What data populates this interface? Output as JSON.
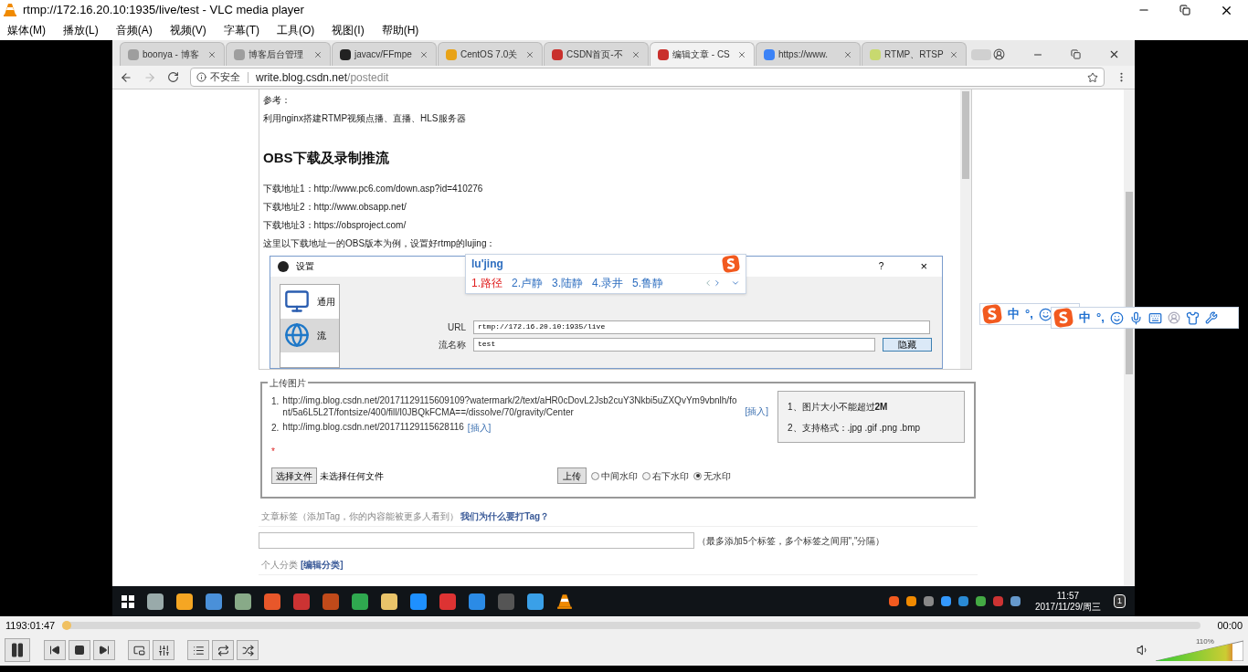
{
  "window": {
    "title": "rtmp://172.16.20.10:1935/live/test - VLC media player"
  },
  "menu": [
    "媒体(M)",
    "播放(L)",
    "音频(A)",
    "视频(V)",
    "字幕(T)",
    "工具(O)",
    "视图(I)",
    "帮助(H)"
  ],
  "browser": {
    "tabs": [
      {
        "label": "boonya - 博客",
        "selected": false,
        "color": "#9e9e9e"
      },
      {
        "label": "博客后台管理",
        "selected": false,
        "color": "#9e9e9e"
      },
      {
        "label": "javacv/FFmpe",
        "selected": false,
        "color": "#222222"
      },
      {
        "label": "CentOS 7.0关",
        "selected": false,
        "color": "#e8a317"
      },
      {
        "label": "CSDN首页-不",
        "selected": false,
        "color": "#c9302c"
      },
      {
        "label": "编辑文章 - CS",
        "selected": true,
        "color": "#c9302c"
      },
      {
        "label": "https://www.",
        "selected": false,
        "color": "#3b82f6"
      },
      {
        "label": "RTMP、RTSP",
        "selected": false,
        "color": "#c8d96f"
      }
    ],
    "address": {
      "security": "不安全",
      "host": "write.blog.csdn.net",
      "path": "/postedit"
    },
    "article": {
      "lines": [
        {
          "kind": "text",
          "text": "参考："
        },
        {
          "kind": "text",
          "text": "利用nginx搭建RTMP视频点播、直播、HLS服务器"
        },
        {
          "kind": "heading",
          "text": "OBS下载及录制推流"
        },
        {
          "kind": "text",
          "text": "下载地址1：http://www.pc6.com/down.asp?id=410276"
        },
        {
          "kind": "text",
          "text": "下载地址2：http://www.obsapp.net/"
        },
        {
          "kind": "text",
          "text": "下载地址3：https://obsproject.com/"
        },
        {
          "kind": "text",
          "text": "这里以下载地址一的OBS版本为例，设置好rtmp的lujing："
        }
      ],
      "obs_dialog": {
        "title": "设置",
        "help": "?",
        "close": "×",
        "sections": [
          {
            "label": "通用",
            "selected": false
          },
          {
            "label": "流",
            "selected": true
          }
        ],
        "fields": [
          {
            "label": "URL",
            "value": "rtmp://172.16.20.10:1935/live"
          },
          {
            "label": "流名称",
            "value": "test"
          }
        ],
        "hide_button": "隐藏"
      }
    },
    "ime": {
      "composition": "lu'jing",
      "candidates": [
        {
          "text": "1.路径",
          "selected": true
        },
        {
          "text": "2.卢静",
          "selected": false
        },
        {
          "text": "3.陆静",
          "selected": false
        },
        {
          "text": "4.录井",
          "selected": false
        },
        {
          "text": "5.鲁静",
          "selected": false
        }
      ]
    },
    "upload": {
      "legend": "上传图片",
      "images": [
        {
          "number": "1.",
          "url": "http://img.blog.csdn.net/20171129115609109?watermark/2/text/aHR0cDovL2Jsb2cuY3Nkbi5uZXQvYm9vbnlh/font/5a6L5L2T/fontsize/400/fill/I0JBQkFCMA==/dissolve/70/gravity/Center",
          "insert": "[插入]"
        },
        {
          "number": "2.",
          "url": "http://img.blog.csdn.net/20171129115628116",
          "insert": "[插入]"
        }
      ],
      "notes": [
        "1、图片大小不能超过**2M**",
        "2、支持格式：.jpg .gif .png .bmp"
      ],
      "required_mark": "*",
      "choose_button": "选择文件",
      "no_file": "未选择任何文件",
      "upload_button": "上传",
      "watermarks": [
        {
          "label": "中间水印",
          "selected": false
        },
        {
          "label": "右下水印",
          "selected": false
        },
        {
          "label": "无水印",
          "selected": true
        }
      ]
    },
    "tags": {
      "label": "文章标签（添加Tag，你的内容能被更多人看到）",
      "link": "我们为什么要打Tag？",
      "hint": "（最多添加5个标签，多个标签之间用\",\"分隔）"
    },
    "category": {
      "label": "个人分类",
      "link": "[编辑分类]"
    }
  },
  "ime_toolbars": [
    {
      "lang": "中",
      "punct": "°,"
    },
    {
      "lang": "中",
      "punct": "°,"
    }
  ],
  "taskbar": {
    "time": "11:57",
    "date": "2017/11/29/周三",
    "notifications": "1"
  },
  "seek": {
    "elapsed": "1193:01:47",
    "total": "00:00",
    "level": 0
  },
  "volume": {
    "reading": "110%",
    "level": 0.88
  }
}
